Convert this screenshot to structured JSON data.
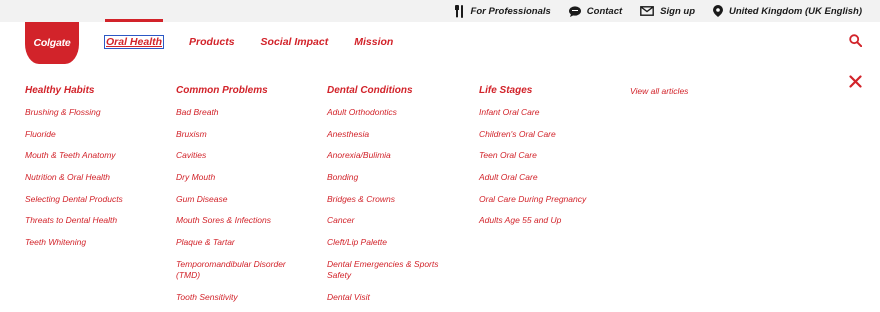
{
  "utility": {
    "professionals": "For Professionals",
    "contact": "Contact",
    "signup": "Sign up",
    "region": "United Kingdom (UK English)"
  },
  "brand": {
    "logo_text": "Colgate",
    "color": "#d2232a"
  },
  "nav": {
    "oral_health": "Oral Health",
    "products": "Products",
    "social_impact": "Social Impact",
    "mission": "Mission"
  },
  "menu": {
    "view_all": "View all articles",
    "healthy_habits": {
      "heading": "Healthy Habits",
      "links": [
        "Brushing & Flossing",
        "Fluoride",
        "Mouth & Teeth Anatomy",
        "Nutrition & Oral Health",
        "Selecting Dental Products",
        "Threats to Dental Health",
        "Teeth Whitening"
      ]
    },
    "common_problems": {
      "heading": "Common Problems",
      "links": [
        "Bad Breath",
        "Bruxism",
        "Cavities",
        "Dry Mouth",
        "Gum Disease",
        "Mouth Sores & Infections",
        "Plaque & Tartar",
        "Temporomandibular Disorder (TMD)",
        "Tooth Sensitivity"
      ]
    },
    "dental_conditions": {
      "heading": "Dental Conditions",
      "links": [
        "Adult Orthodontics",
        "Anesthesia",
        "Anorexia/Bulimia",
        "Bonding",
        "Bridges & Crowns",
        "Cancer",
        "Cleft/Lip Palette",
        "Dental Emergencies & Sports Safety",
        "Dental Visit"
      ]
    },
    "life_stages": {
      "heading": "Life Stages",
      "links": [
        "Infant Oral Care",
        "Children's Oral Care",
        "Teen Oral Care",
        "Adult Oral Care",
        "Oral Care During Pregnancy",
        "Adults Age 55 and Up"
      ]
    }
  },
  "icons": {
    "professionals": "tooth-tool-icon",
    "contact": "chat-bubble-icon",
    "signup": "envelope-icon",
    "region": "location-pin-icon",
    "search": "search-icon",
    "close": "close-icon"
  }
}
